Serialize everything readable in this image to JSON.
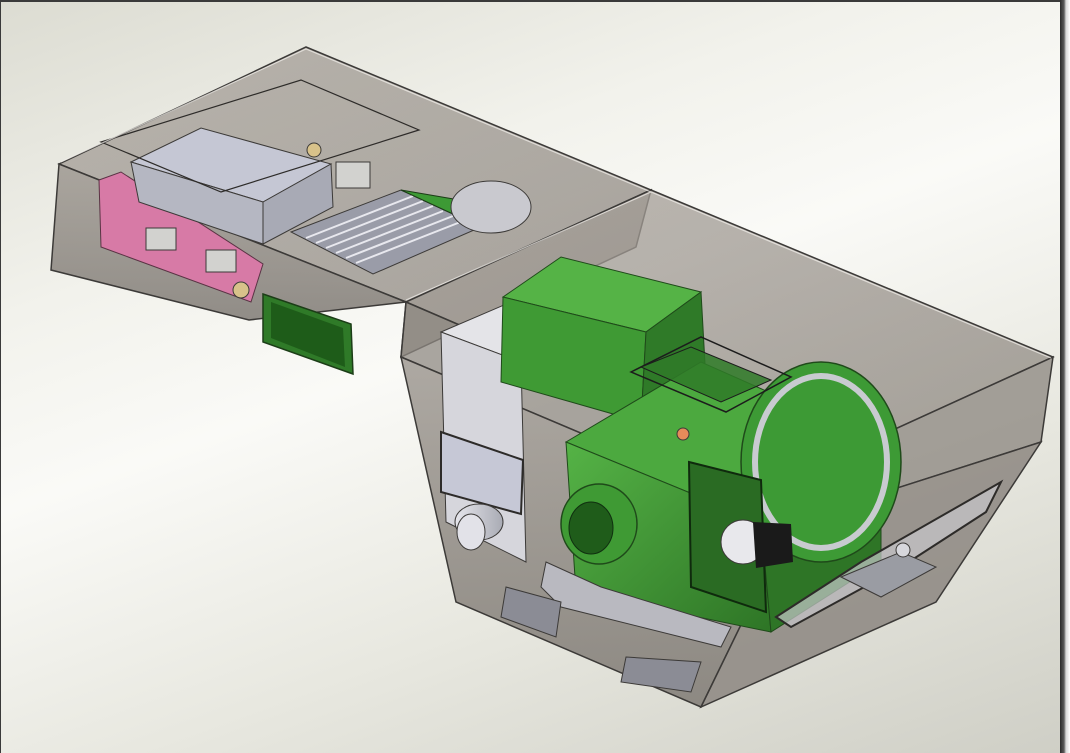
{
  "scene": {
    "description_kind": "cad-3d-viewport",
    "colors": {
      "background_light": "#fafaf7",
      "background_dark": "#cfcfc6",
      "enclosure": "#8f8a84",
      "enclosure_edge": "#3c3a38",
      "motor_green": "#3f9a34",
      "motor_green_dark": "#2c6e24",
      "pcb_pink": "#d77aa6",
      "metal": "#c9c9d0",
      "heatsink": "#9a9ca8"
    },
    "icons": {
      "model": "cad-assembly-icon"
    }
  }
}
